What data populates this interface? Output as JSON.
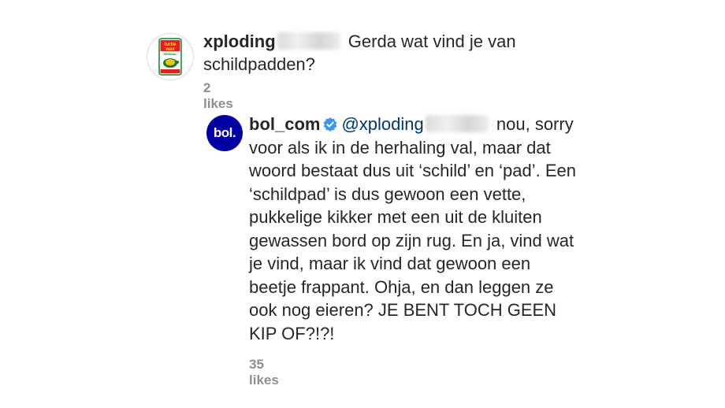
{
  "comment": {
    "username": "xploding",
    "text": "Gerda wat vind je van schildpadden?",
    "likes": "2 likes",
    "avatar_icon": "turtle-wax-logo",
    "avatar_text_top": "turtle",
    "avatar_text_bottom": "wax",
    "avatar_text_original": "ORIGINAL"
  },
  "reply": {
    "username": "bol_com",
    "verified_icon": "verified-badge-icon",
    "mention": "@xploding",
    "text": "nou, sorry voor als ik in de herhaling val, maar dat woord bestaat dus uit ‘schild’ en ‘pad’. Een ‘schildpad’ is dus gewoon een vette, pukkelige kikker met een uit de kluiten gewassen bord op zijn rug. En ja, vind wat je vind, maar ik vind dat gewoon een beetje frappant. Ohja, en dan leggen ze ook nog eieren? JE BENT TOCH GEEN KIP OF?!?!",
    "likes": "35 likes",
    "avatar_text": "bol.",
    "brand_color": "#0000a4"
  },
  "colors": {
    "text": "#262626",
    "muted": "#8e8e8e",
    "mention": "#00376b",
    "verified": "#3897f0"
  }
}
